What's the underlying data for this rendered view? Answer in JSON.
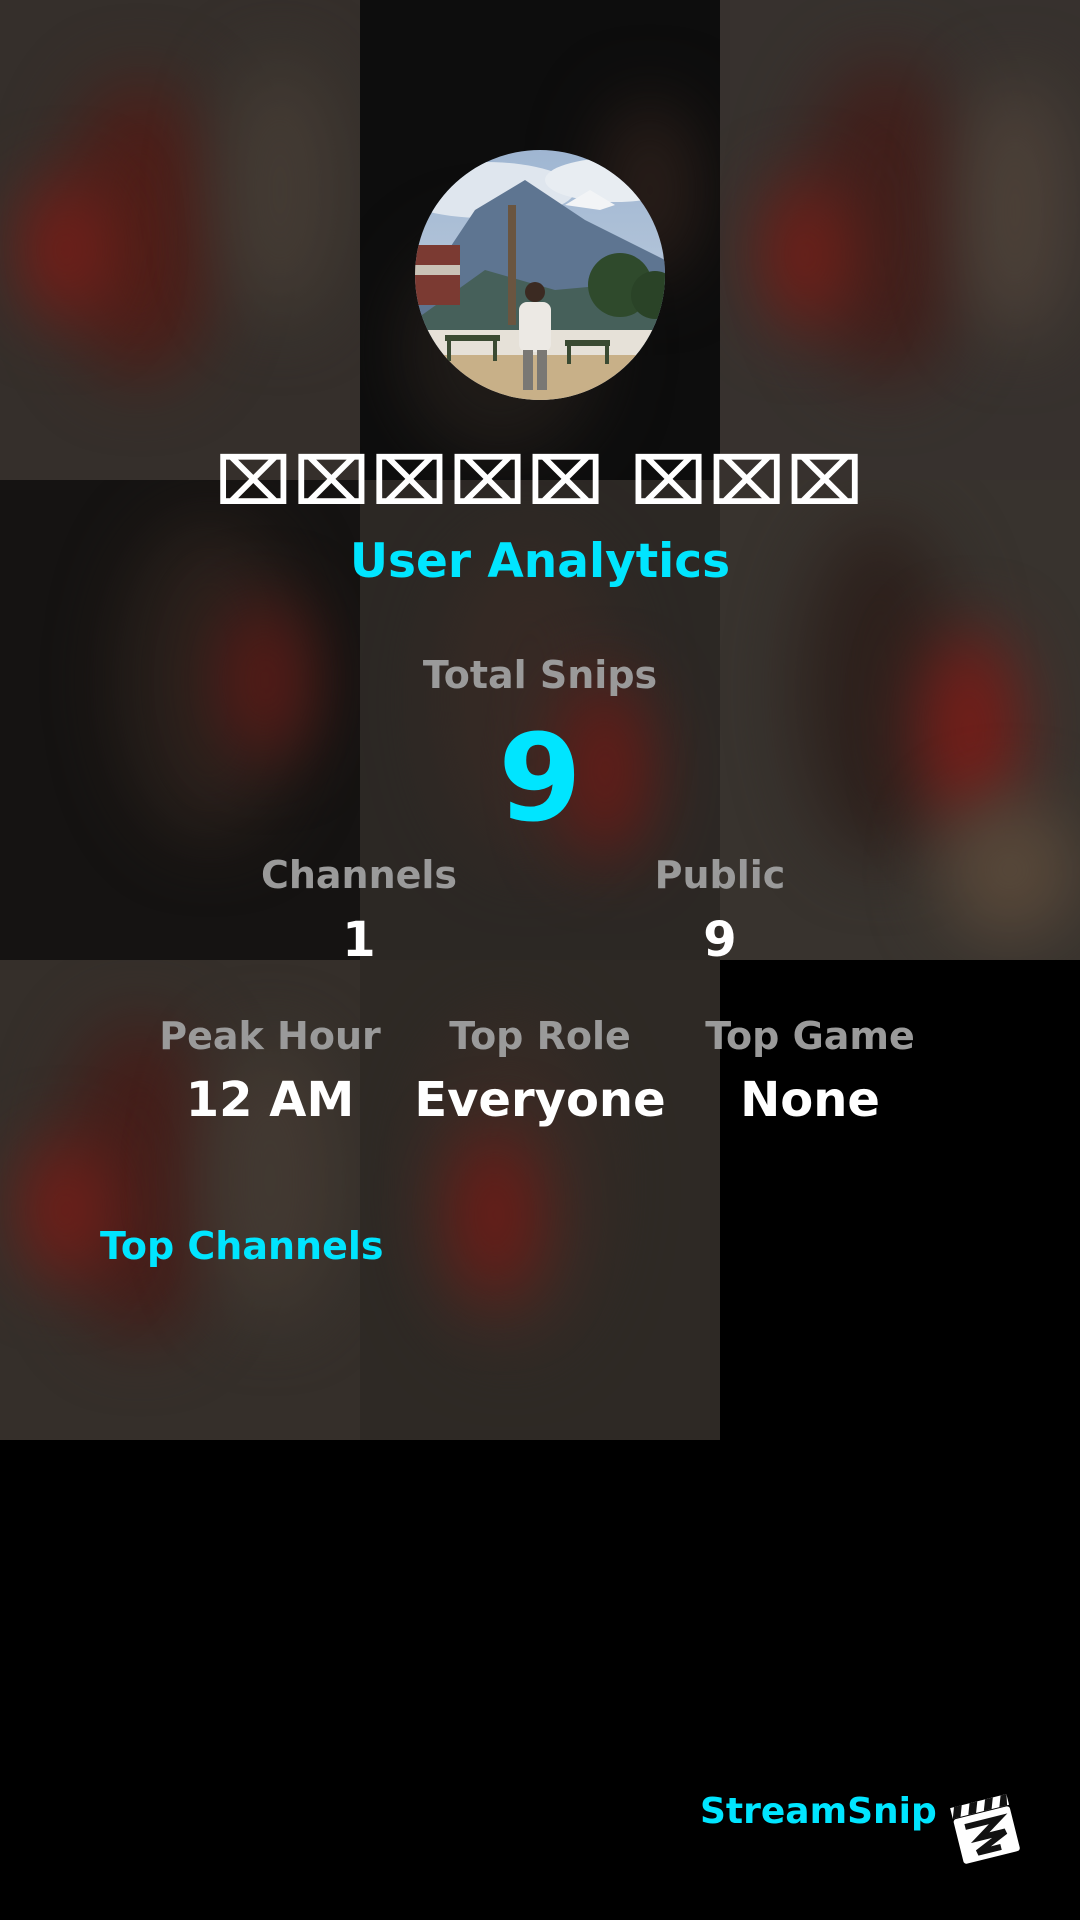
{
  "profile": {
    "username": "⌧⌧⌧⌧⌧ ⌧⌧⌧",
    "avatar_icon": "profile-photo-mountain-icon"
  },
  "header": {
    "subtitle": "User Analytics"
  },
  "stats": {
    "total_snips_label": "Total Snips",
    "total_snips_value": "9",
    "channels_label": "Channels",
    "channels_value": "1",
    "public_label": "Public",
    "public_value": "9",
    "peak_hour_label": "Peak Hour",
    "peak_hour_value": "12 AM",
    "top_role_label": "Top Role",
    "top_role_value": "Everyone",
    "top_game_label": "Top Game",
    "top_game_value": "None"
  },
  "sections": {
    "top_channels_title": "Top Channels"
  },
  "brand": {
    "name": "StreamSnip",
    "logo_icon": "clapperboard-icon"
  },
  "colors": {
    "accent": "#00e5ff",
    "background": "#000000",
    "label_gray": "#9a9a9a",
    "value_white": "#ffffff"
  }
}
